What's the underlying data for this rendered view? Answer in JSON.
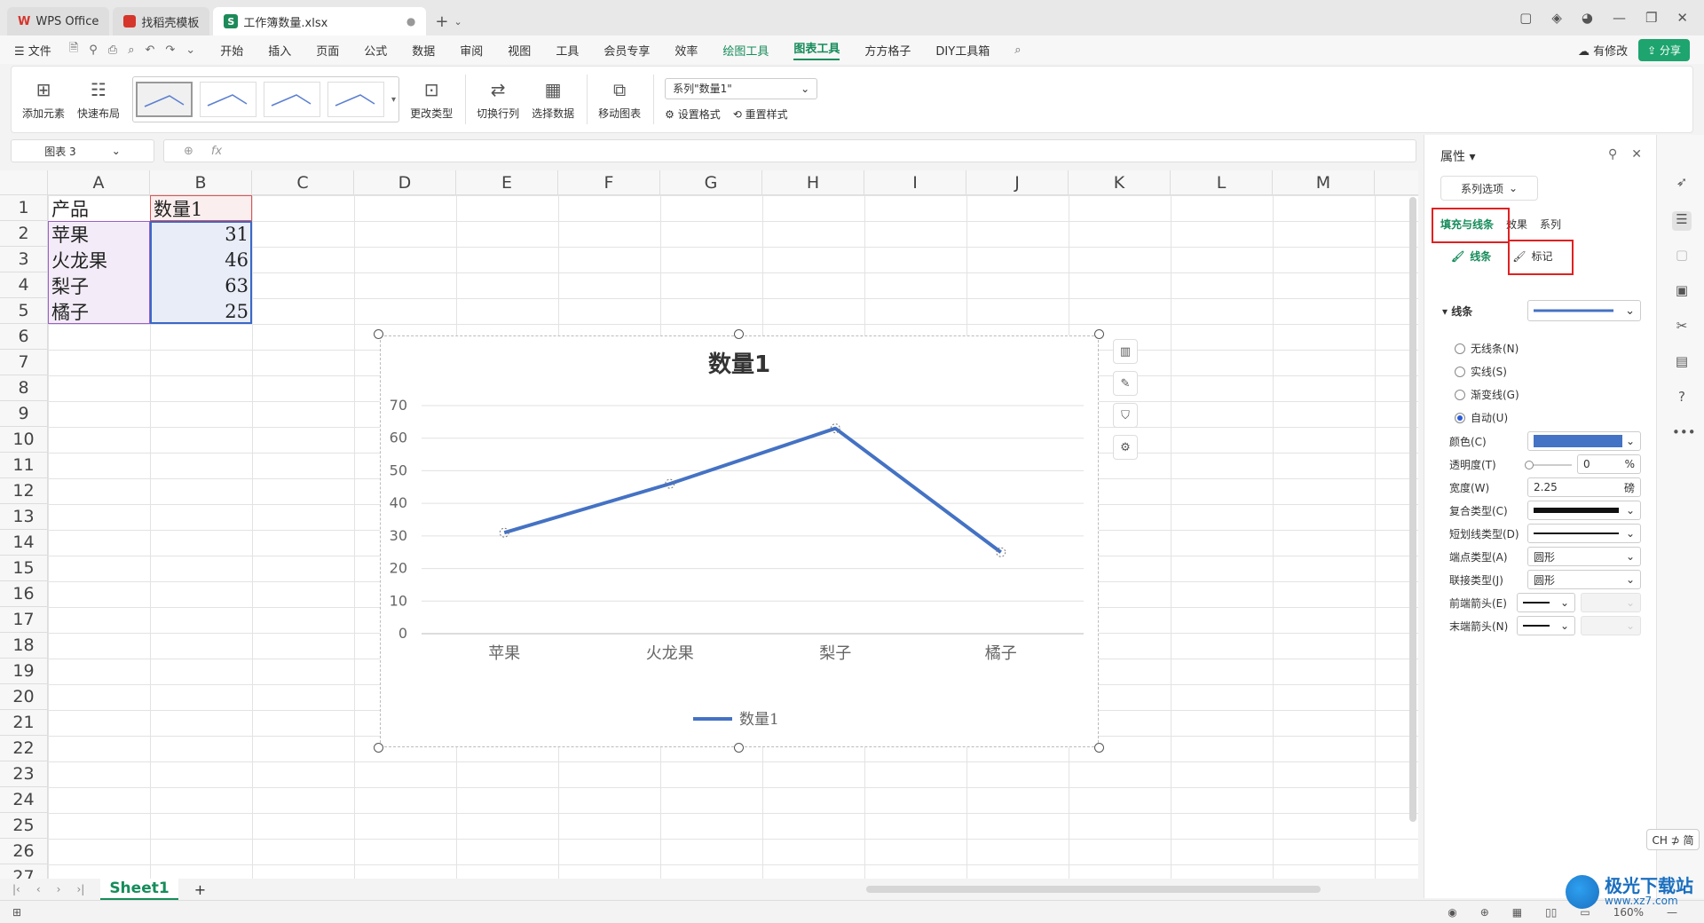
{
  "titlebar": {
    "tabs": [
      {
        "label": "WPS Office"
      },
      {
        "label": "找稻壳模板"
      },
      {
        "label": "工作簿数量.xlsx"
      }
    ]
  },
  "menubar": {
    "file": "文件",
    "items": [
      "开始",
      "插入",
      "页面",
      "公式",
      "数据",
      "审阅",
      "视图",
      "工具",
      "会员专享",
      "效率",
      "绘图工具",
      "图表工具",
      "方方格子",
      "DIY工具箱"
    ],
    "modified": "有修改",
    "share": "分享"
  },
  "ribbon": {
    "add_element": "添加元素",
    "quick_layout": "快速布局",
    "change_type": "更改类型",
    "switch_rowcol": "切换行列",
    "select_data": "选择数据",
    "move_chart": "移动图表",
    "series_select": "系列\"数量1\"",
    "set_format": "设置格式",
    "reset_style": "重置样式"
  },
  "namebox": "图表 3",
  "formula": {
    "fx": "fx",
    "value": ""
  },
  "grid": {
    "columns": [
      "A",
      "B",
      "C",
      "D",
      "E",
      "F",
      "G",
      "H",
      "I",
      "J",
      "K",
      "L",
      "M"
    ],
    "rows": [
      "1",
      "2",
      "3",
      "4",
      "5",
      "6",
      "7",
      "8",
      "9",
      "10",
      "11",
      "12",
      "13",
      "14",
      "15",
      "16",
      "17",
      "18",
      "19",
      "20",
      "21",
      "22",
      "23",
      "24",
      "25",
      "26",
      "27"
    ],
    "header": [
      "产品",
      "数量1"
    ],
    "data": [
      {
        "product": "苹果",
        "qty": "31"
      },
      {
        "product": "火龙果",
        "qty": "46"
      },
      {
        "product": "梨子",
        "qty": "63"
      },
      {
        "product": "橘子",
        "qty": "25"
      }
    ]
  },
  "chart_data": {
    "type": "line",
    "title": "数量1",
    "categories": [
      "苹果",
      "火龙果",
      "梨子",
      "橘子"
    ],
    "series": [
      {
        "name": "数量1",
        "values": [
          31,
          46,
          63,
          25
        ],
        "color": "#4472c4"
      }
    ],
    "ylim": [
      0,
      70
    ],
    "yticks": [
      0,
      10,
      20,
      30,
      40,
      50,
      60,
      70
    ],
    "grid": true,
    "legend": "bottom"
  },
  "sheets": {
    "active": "Sheet1",
    "add": "+"
  },
  "statusbar": {
    "zoom": "160%"
  },
  "panel": {
    "title": "属性",
    "option": "系列选项",
    "tabs": [
      "填充与线条",
      "效果",
      "系列"
    ],
    "inner_tabs": [
      "线条",
      "标记"
    ],
    "section": "线条",
    "radios": [
      "无线条(N)",
      "实线(S)",
      "渐变线(G)",
      "自动(U)"
    ],
    "color_label": "颜色(C)",
    "color_value": "#4472c4",
    "transparency_label": "透明度(T)",
    "transparency_value": "0",
    "transparency_unit": "%",
    "width_label": "宽度(W)",
    "width_value": "2.25",
    "width_unit": "磅",
    "compound_label": "复合类型(C)",
    "dash_label": "短划线类型(D)",
    "cap_label": "端点类型(A)",
    "cap_value": "圆形",
    "join_label": "联接类型(J)",
    "join_value": "圆形",
    "begin_arrow_label": "前端箭头(E)",
    "end_arrow_label": "末端箭头(N)"
  },
  "ime": "CH ⊅ 简",
  "watermark": {
    "name": "极光下载站",
    "url": "www.xz7.com"
  }
}
